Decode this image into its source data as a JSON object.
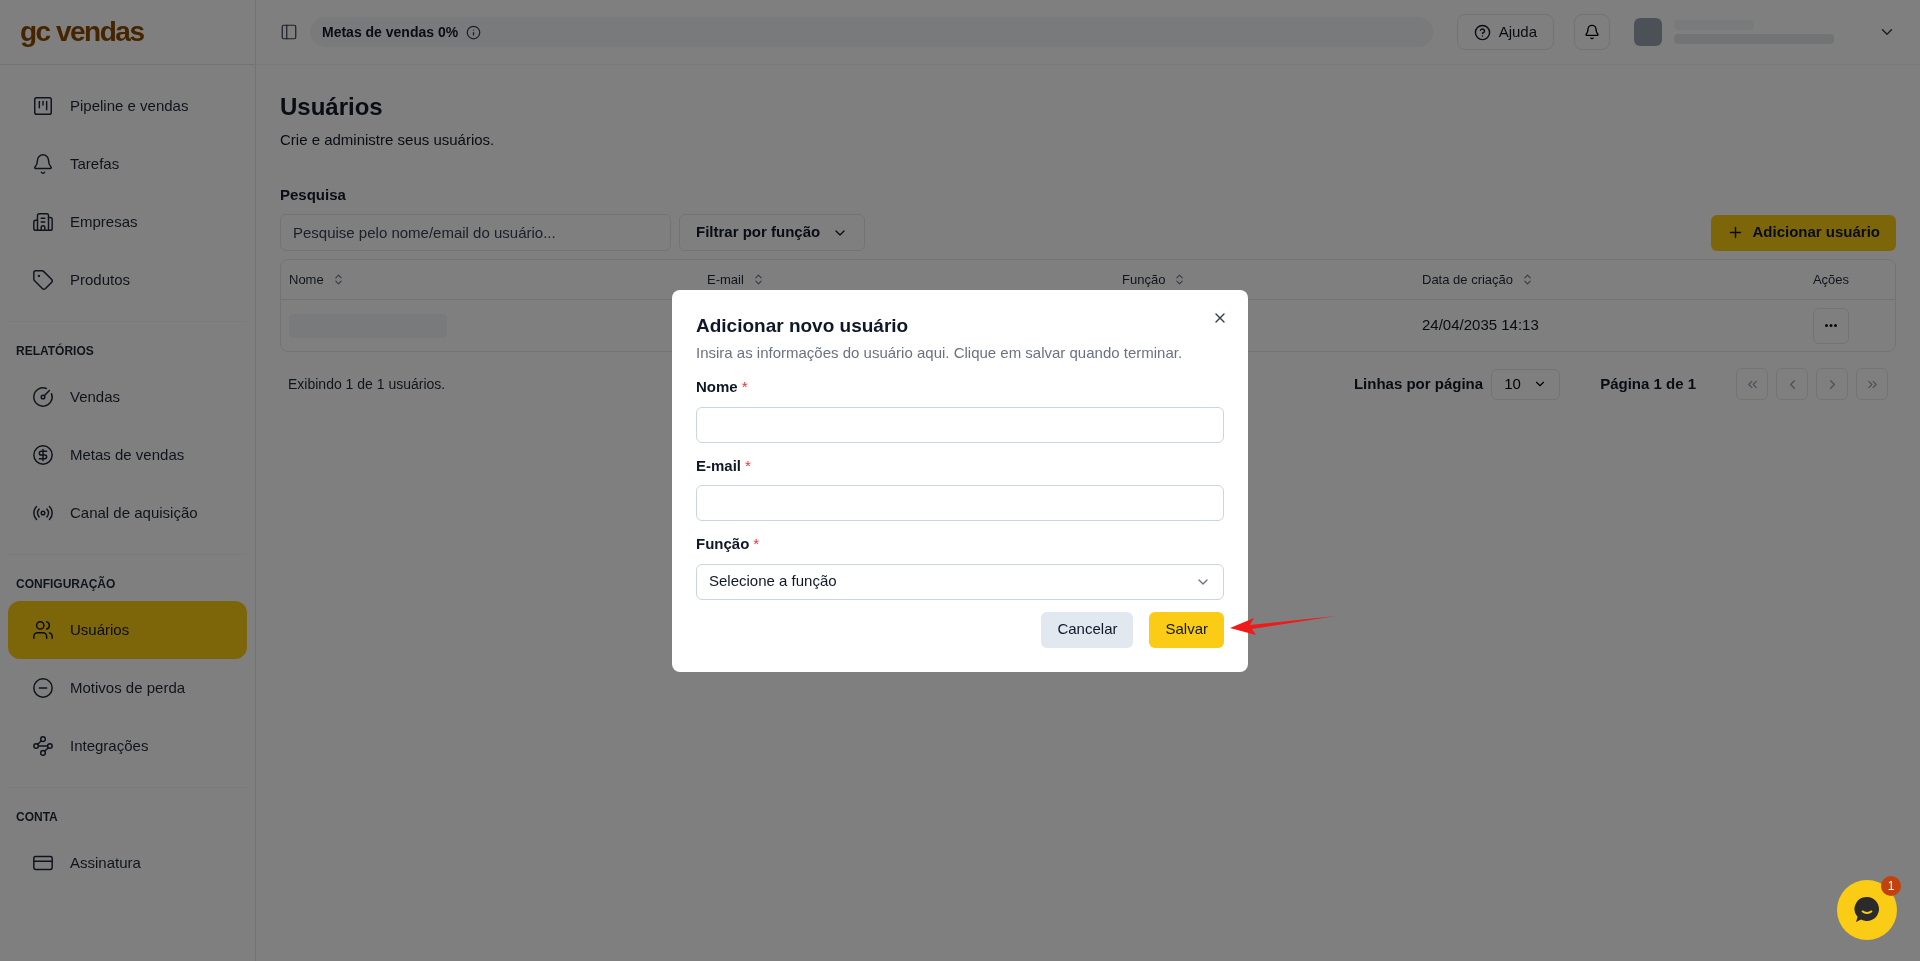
{
  "logo": "gc vendas",
  "sidebar": {
    "sections": [
      {
        "items": [
          {
            "label": "Pipeline e vendas",
            "selected": false
          },
          {
            "label": "Tarefas",
            "selected": false
          },
          {
            "label": "Empresas",
            "selected": false
          },
          {
            "label": "Produtos",
            "selected": false
          }
        ]
      },
      {
        "heading": "RELATÓRIOS",
        "items": [
          {
            "label": "Vendas",
            "selected": false
          },
          {
            "label": "Metas de vendas",
            "selected": false
          },
          {
            "label": "Canal de aquisição",
            "selected": false
          }
        ]
      },
      {
        "heading": "CONFIGURAÇÃO",
        "items": [
          {
            "label": "Usuários",
            "selected": true
          },
          {
            "label": "Motivos de perda",
            "selected": false
          },
          {
            "label": "Integrações",
            "selected": false
          }
        ]
      },
      {
        "heading": "CONTA",
        "items": [
          {
            "label": "Assinatura",
            "selected": false
          }
        ]
      }
    ]
  },
  "header": {
    "goal": "Metas de vendas 0%",
    "help_button": "Ajuda"
  },
  "page": {
    "title": "Usuários",
    "subtitle": "Crie e administre seus usuários.",
    "search_label": "Pesquisa",
    "search": {
      "placeholder": "Pesquise pelo nome/email do usuário..."
    },
    "filter_button": "Filtrar por função",
    "add_button": "Adicionar usuário"
  },
  "table": {
    "columns": [
      {
        "label": "Nome",
        "sortable": true
      },
      {
        "label": "E-mail",
        "sortable": true
      },
      {
        "label": "Função",
        "sortable": true
      },
      {
        "label": "Data de criação",
        "sortable": true
      },
      {
        "label": "Ações",
        "sortable": false
      }
    ],
    "rows": [
      {
        "created": "24/04/2035 14:13"
      }
    ]
  },
  "footer": {
    "summary": "Exibindo 1 de 1 usuários.",
    "rows_label": "Linhas por página",
    "rows_value": "10",
    "page_info": "Página 1 de 1"
  },
  "dialog": {
    "title": "Adicionar novo usuário",
    "description": "Insira as informações do usuário aqui. Clique em salvar quando terminar.",
    "fields": [
      {
        "kind": "input",
        "label": "Nome",
        "required": true
      },
      {
        "kind": "input",
        "label": "E-mail",
        "required": true
      },
      {
        "kind": "select",
        "label": "Função",
        "required": true,
        "value": "Selecione a função"
      }
    ],
    "required_mark": "*",
    "cancel": "Cancelar",
    "save": "Salvar"
  },
  "chat": {
    "badge": "1"
  }
}
